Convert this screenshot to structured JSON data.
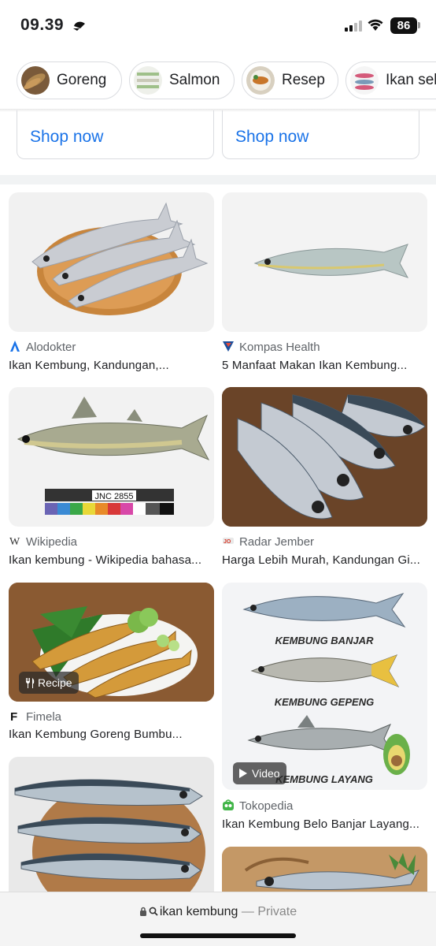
{
  "status": {
    "time": "09.39",
    "battery": "86"
  },
  "chips": [
    {
      "label": "Goreng"
    },
    {
      "label": "Salmon"
    },
    {
      "label": "Resep"
    },
    {
      "label": "Ikan sel"
    }
  ],
  "shop": {
    "left_label": "Shop now",
    "right_label": "Shop now"
  },
  "results": [
    {
      "source": "Alodokter",
      "title": "Ikan Kembung, Kandungan,...",
      "icon": "alodokter-logo-icon"
    },
    {
      "source": "Kompas Health",
      "title": "5 Manfaat Makan Ikan Kembung...",
      "icon": "kompas-logo-icon"
    },
    {
      "source": "Wikipedia",
      "title": "Ikan kembung - Wikipedia bahasa...",
      "icon": "wikipedia-logo-icon"
    },
    {
      "source": "Radar Jember",
      "title": "Harga Lebih Murah, Kandungan Gi...",
      "icon": "radar-logo-icon"
    },
    {
      "source": "Fimela",
      "title": "Ikan Kembung Goreng Bumbu...",
      "icon": "fimela-logo-icon",
      "badge": "Recipe"
    },
    {
      "source": "Tokopedia",
      "title": "Ikan Kembung Belo Banjar Layang...",
      "icon": "tokopedia-logo-icon",
      "badge": "Video"
    }
  ],
  "image_text": {
    "ruler": "JNC 2855",
    "kembung_banjar": "KEMBUNG BANJAR",
    "kembung_gepeng": "KEMBUNG GEPENG",
    "kembung_layang": "KEMBUNG LAYANG"
  },
  "address_bar": {
    "query": "ikan kembung",
    "mode": "— Private"
  },
  "colors": {
    "link": "#1a73e8",
    "badge_bg": "#3a3a3a"
  }
}
